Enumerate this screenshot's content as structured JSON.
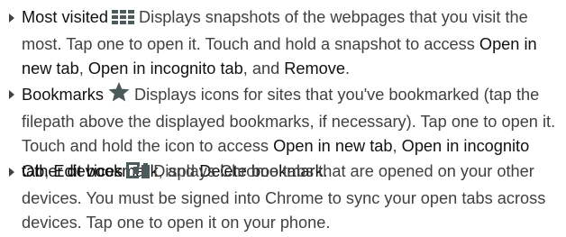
{
  "items": [
    {
      "title": "Most visited",
      "icon": "grid-icon",
      "d1": "Displays snapshots of the webpages that you visit the most. Tap one to open it. Touch and hold a snapshot to access",
      "o1": "Open in new tab",
      "s1": ",",
      "o2": "Open in incognito tab",
      "s2": ", and",
      "o3": "Remove",
      "end": "."
    },
    {
      "title": "Bookmarks",
      "icon": "star-icon",
      "d1": "Displays icons for sites that you've bookmarked (tap the filepath above the displayed bookmarks, if necessary). Tap one to open it. Touch and hold the icon to access",
      "o1": "Open in new tab",
      "s1": ",",
      "o2": "Open in incognito tab",
      "s2": ",",
      "o3": "Edit bookmark",
      "s3": ", and",
      "o4": "Delete bookmark",
      "end": "."
    },
    {
      "title": "Other devices",
      "icon": "devices-icon",
      "d1": "Displays Chrome tabs that are opened on your other devices. You must be signed into Chrome to sync your open tabs across devices. Tap one to open it on your phone."
    }
  ],
  "colors": {
    "text": "#414141",
    "icon": "#4b5a5a"
  }
}
